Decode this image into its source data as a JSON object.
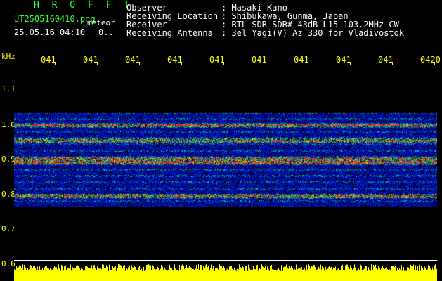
{
  "header": {
    "app_title": "H R O F F T",
    "file_name": "UT2505160410.png",
    "timestamp": "25.05.16 04:10",
    "mode_label": "meteor",
    "mode_value": "0.."
  },
  "station": [
    {
      "label": "Observer",
      "value": ": Masaki Kano"
    },
    {
      "label": "Receiving Location",
      "value": ": Shibukawa, Gunma, Japan"
    },
    {
      "label": "Receiver",
      "value": ": RTL-SDR SDR# 43dB L15 103.2MHz CW"
    },
    {
      "label": "Receiving Antenna",
      "value": ": 3el Yagi(V) Az 330 for Vladivostok"
    }
  ],
  "time_axis": {
    "ticks": [
      "041",
      "041",
      "041",
      "041",
      "041",
      "041",
      "041",
      "041",
      "041",
      "0420"
    ]
  },
  "freq_axis": {
    "unit": "kHz",
    "ticks": [
      "1.1",
      "1.0",
      "0.9",
      "0.8",
      "0.7",
      "0.6"
    ]
  },
  "colors": {
    "background": "#000000",
    "axis": "#ffff00",
    "title": "#33ff33",
    "text": "#ffffff",
    "meter": "#ffff00"
  }
}
